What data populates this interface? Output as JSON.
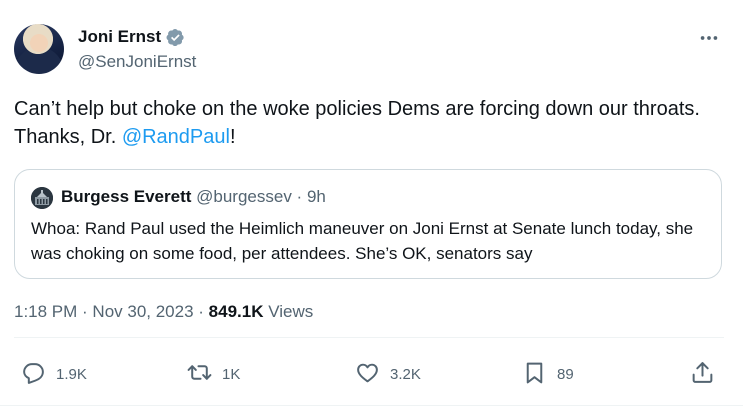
{
  "author": {
    "display_name": "Joni Ernst",
    "handle": "@SenJoniErnst",
    "verified_icon": "verified-badge-icon"
  },
  "tweet": {
    "text_before": "Can’t help but choke on the woke policies Dems are forcing down our throats. Thanks, Dr. ",
    "mention": "@RandPaul",
    "text_after": "!"
  },
  "quoted": {
    "display_name": "Burgess Everett",
    "handle": "@burgessev",
    "separator": " · ",
    "time": "9h",
    "text": "Whoa: Rand Paul used the Heimlich maneuver on Joni Ernst at Senate lunch today, she was choking on some food, per attendees. She’s OK, senators say"
  },
  "meta": {
    "time": "1:18 PM",
    "dot1": " · ",
    "date": "Nov 30, 2023",
    "dot2": " · ",
    "views_count": "849.1K",
    "views_label": " Views"
  },
  "actions": {
    "reply_count": "1.9K",
    "retweet_count": "1K",
    "like_count": "3.2K",
    "bookmark_count": "89"
  },
  "colors": {
    "accent": "#1d9bf0",
    "secondary_text": "#536471",
    "primary_text": "#0f1419",
    "border": "#cfd9de"
  }
}
